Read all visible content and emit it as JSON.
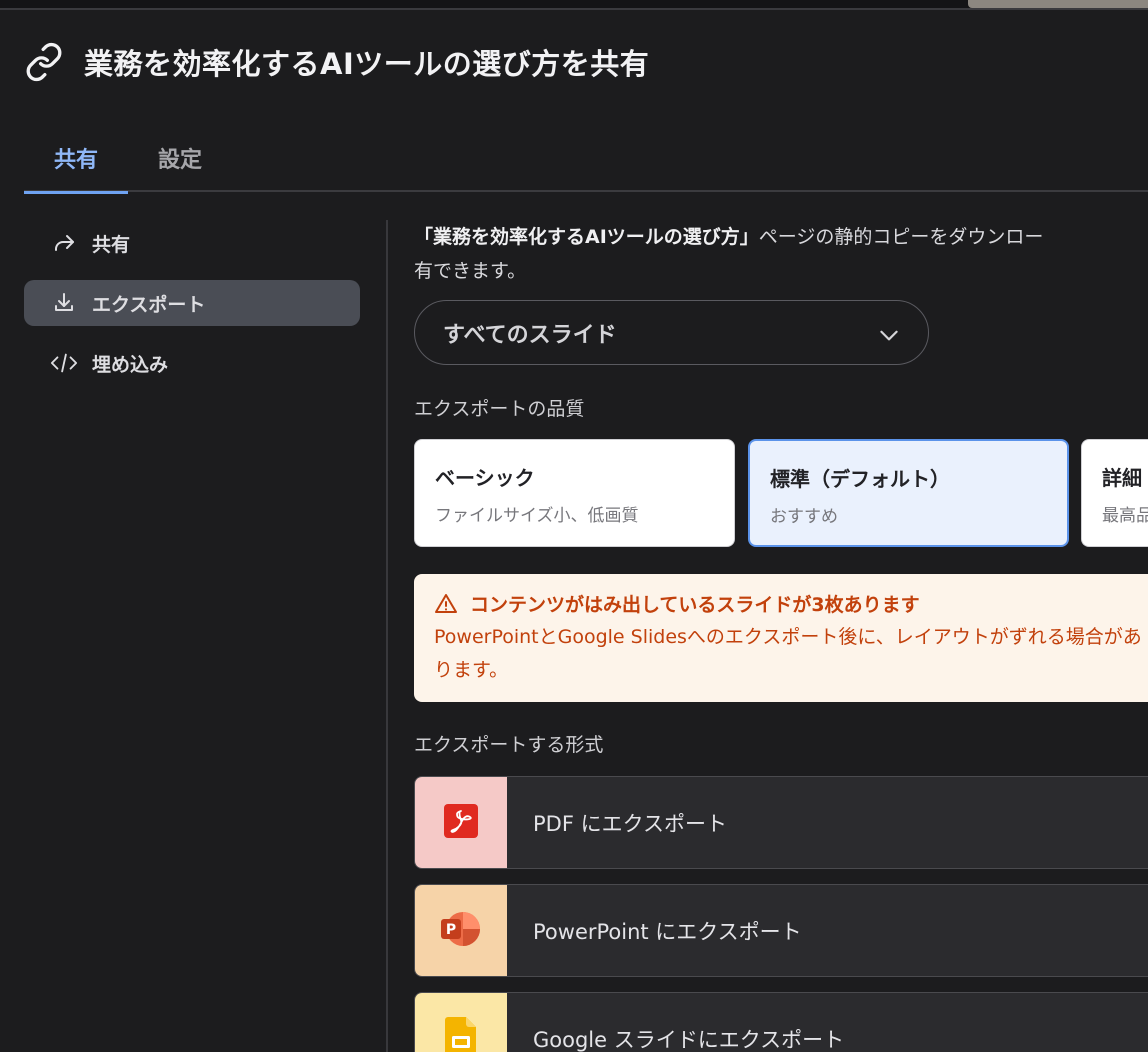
{
  "window": {
    "title": "業務を効率化するAIツールの選び方を共有"
  },
  "tabs": [
    {
      "label": "共有",
      "active": true
    },
    {
      "label": "設定",
      "active": false
    }
  ],
  "sidebar": {
    "items": [
      {
        "label": "共有",
        "icon": "share-arrow-icon",
        "active": false
      },
      {
        "label": "エクスポート",
        "icon": "download-icon",
        "active": true
      },
      {
        "label": "埋め込み",
        "icon": "code-icon",
        "active": false
      }
    ]
  },
  "main": {
    "intro_bold": "「業務を効率化するAIツールの選び方」",
    "intro_rest": "ページの静的コピーをダウンロー",
    "intro_line2": "有できます。",
    "slide_select": {
      "value": "すべてのスライド"
    },
    "quality_label": "エクスポートの品質",
    "quality_options": [
      {
        "title": "ベーシック",
        "subtitle": "ファイルサイズ小、低画質",
        "selected": false
      },
      {
        "title": "標準（デフォルト）",
        "subtitle": "おすすめ",
        "selected": true
      },
      {
        "title": "詳細",
        "subtitle": "最高品",
        "selected": false
      }
    ],
    "warning": {
      "title": "コンテンツがはみ出しているスライドが3枚あります",
      "body": "PowerPointとGoogle Slidesへのエクスポート後に、レイアウトがずれる場合があります。",
      "color": "#c2410c"
    },
    "format_label": "エクスポートする形式",
    "formats": [
      {
        "label": "PDF にエクスポート",
        "icon": "pdf-icon",
        "tile_color": "#f5c9c7"
      },
      {
        "label": "PowerPoint にエクスポート",
        "icon": "powerpoint-icon",
        "tile_color": "#f6d3a8"
      },
      {
        "label": "Google スライドにエクスポート",
        "icon": "google-slides-icon",
        "tile_color": "#fbe7a6"
      }
    ]
  },
  "colors": {
    "background": "#1c1c1e",
    "accent": "#6fa3f2",
    "selected_card": "#eaf1fd"
  }
}
